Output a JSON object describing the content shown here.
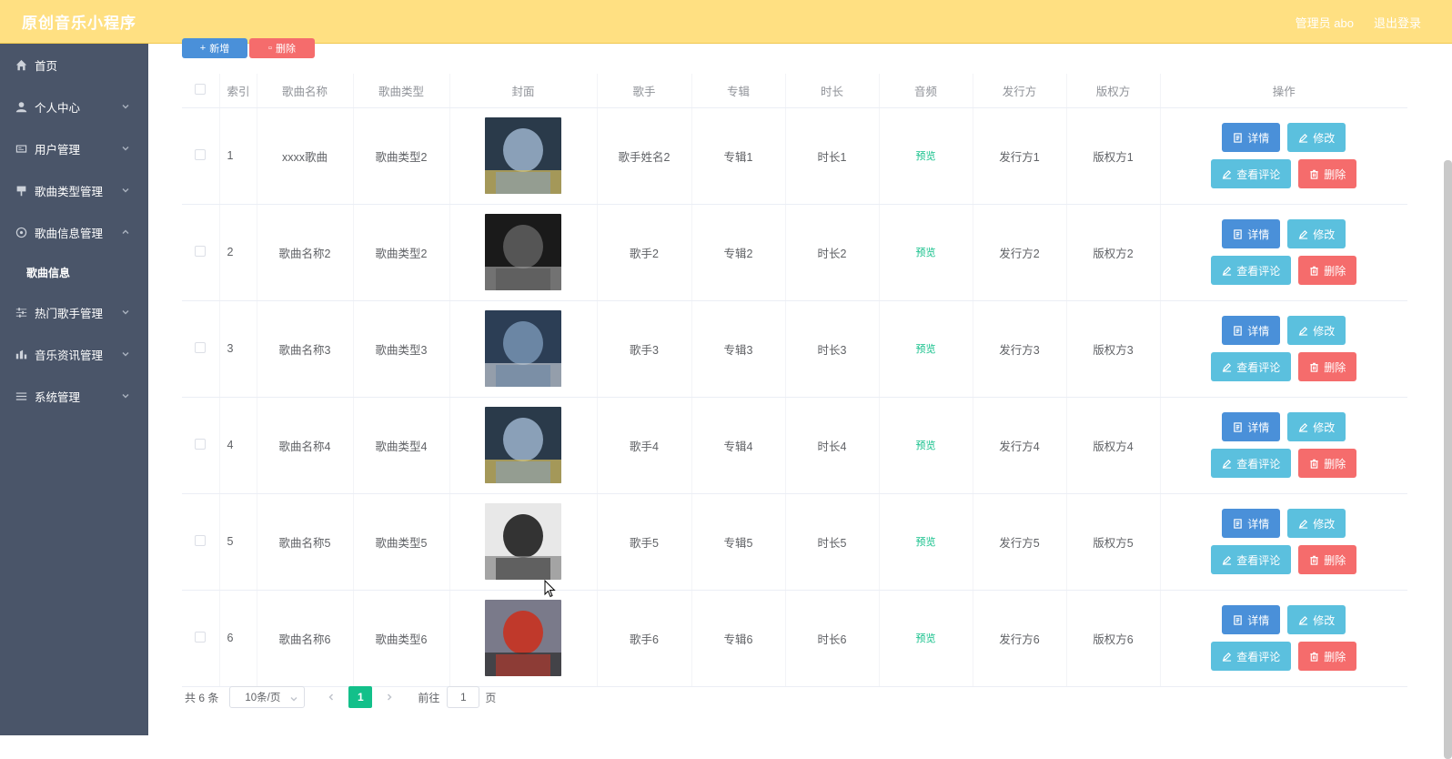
{
  "header": {
    "title": "原创音乐小程序",
    "user": "管理员 abo",
    "logout": "退出登录"
  },
  "sidebar": {
    "items": [
      {
        "label": "首页",
        "icon": "home-icon"
      },
      {
        "label": "个人中心",
        "icon": "user-icon"
      },
      {
        "label": "用户管理",
        "icon": "id-card-icon"
      },
      {
        "label": "歌曲类型管理",
        "icon": "tag-icon"
      },
      {
        "label": "歌曲信息管理",
        "icon": "disc-icon",
        "expanded": true,
        "children": [
          "歌曲信息"
        ]
      },
      {
        "label": "热门歌手管理",
        "icon": "sliders-icon"
      },
      {
        "label": "音乐资讯管理",
        "icon": "news-icon"
      },
      {
        "label": "系统管理",
        "icon": "menu-icon"
      }
    ]
  },
  "toolbar": {
    "add": "新增",
    "delete": "删除"
  },
  "table": {
    "columns": [
      "索引",
      "歌曲名称",
      "歌曲类型",
      "封面",
      "歌手",
      "专辑",
      "时长",
      "音频",
      "发行方",
      "版权方",
      "操作"
    ],
    "rows": [
      {
        "index": "1",
        "name": "xxxx歌曲",
        "type": "歌曲类型2",
        "singer": "歌手姓名2",
        "album": "专辑1",
        "duration": "时长1",
        "audio": "预览",
        "publisher": "发行方1",
        "copyright": "版权方1"
      },
      {
        "index": "2",
        "name": "歌曲名称2",
        "type": "歌曲类型2",
        "singer": "歌手2",
        "album": "专辑2",
        "duration": "时长2",
        "audio": "预览",
        "publisher": "发行方2",
        "copyright": "版权方2"
      },
      {
        "index": "3",
        "name": "歌曲名称3",
        "type": "歌曲类型3",
        "singer": "歌手3",
        "album": "专辑3",
        "duration": "时长3",
        "audio": "预览",
        "publisher": "发行方3",
        "copyright": "版权方3"
      },
      {
        "index": "4",
        "name": "歌曲名称4",
        "type": "歌曲类型4",
        "singer": "歌手4",
        "album": "专辑4",
        "duration": "时长4",
        "audio": "预览",
        "publisher": "发行方4",
        "copyright": "版权方4"
      },
      {
        "index": "5",
        "name": "歌曲名称5",
        "type": "歌曲类型5",
        "singer": "歌手5",
        "album": "专辑5",
        "duration": "时长5",
        "audio": "预览",
        "publisher": "发行方5",
        "copyright": "版权方5"
      },
      {
        "index": "6",
        "name": "歌曲名称6",
        "type": "歌曲类型6",
        "singer": "歌手6",
        "album": "专辑6",
        "duration": "时长6",
        "audio": "预览",
        "publisher": "发行方6",
        "copyright": "版权方6"
      }
    ],
    "actions": {
      "detail": "详情",
      "edit": "修改",
      "comments": "查看评论",
      "delete": "删除"
    }
  },
  "pagination": {
    "total": "共 6 条",
    "page_size": "10条/页",
    "current": "1",
    "goto_label": "前往",
    "goto_value": "1",
    "goto_unit": "页"
  },
  "colors": {
    "header": "#ffe082",
    "sidebar": "#4a5569",
    "primary": "#4a90d9",
    "info": "#5bc0de",
    "danger": "#f56c6c",
    "accent": "#13c08a"
  }
}
